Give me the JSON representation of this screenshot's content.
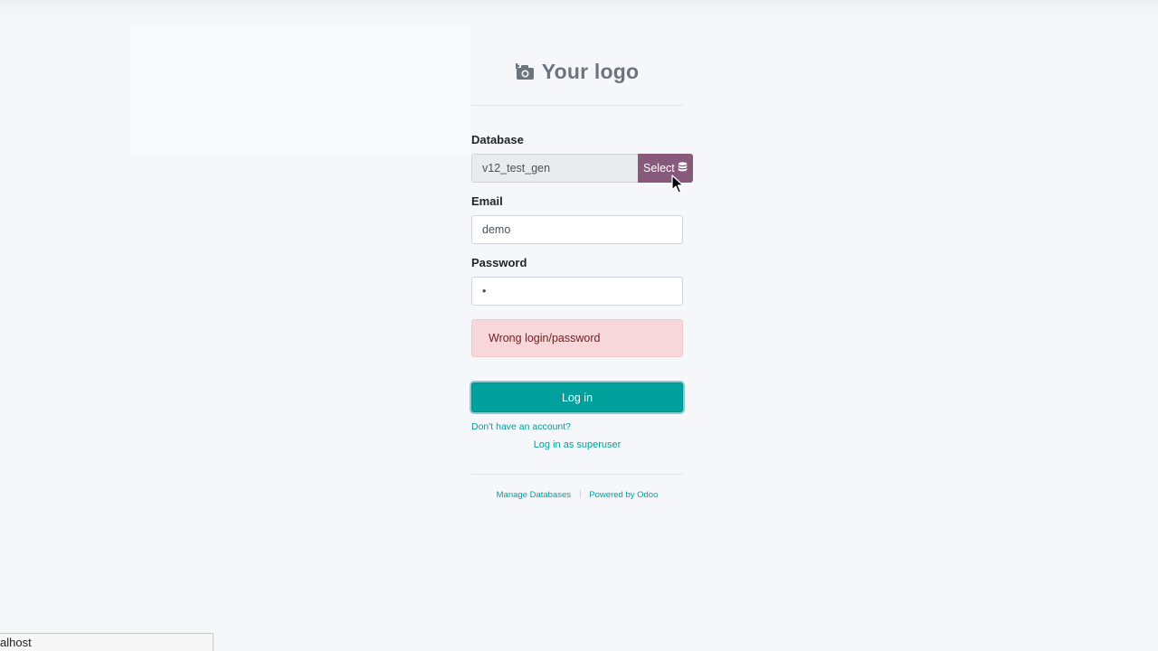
{
  "logo": {
    "text": "Your logo",
    "icon": "camera-icon",
    "color": "#6c757d"
  },
  "form": {
    "database": {
      "label": "Database",
      "value": "v12_test_gen",
      "select_label": "Select",
      "select_icon": "database-icon"
    },
    "email": {
      "label": "Email",
      "value": "demo"
    },
    "password": {
      "label": "Password",
      "value": "•"
    },
    "error": "Wrong login/password",
    "login_label": "Log in",
    "signup_link": "Don't have an account?",
    "superuser_link": "Log in as superuser"
  },
  "footer": {
    "manage_databases": "Manage Databases",
    "powered_by": "Powered by Odoo"
  },
  "statusbar": {
    "text": "alhost"
  },
  "colors": {
    "primary": "#875a7b",
    "accent": "#00a09d",
    "alert_bg": "#f8d7da",
    "alert_text": "#721c24",
    "background": "#f6f7fa"
  }
}
